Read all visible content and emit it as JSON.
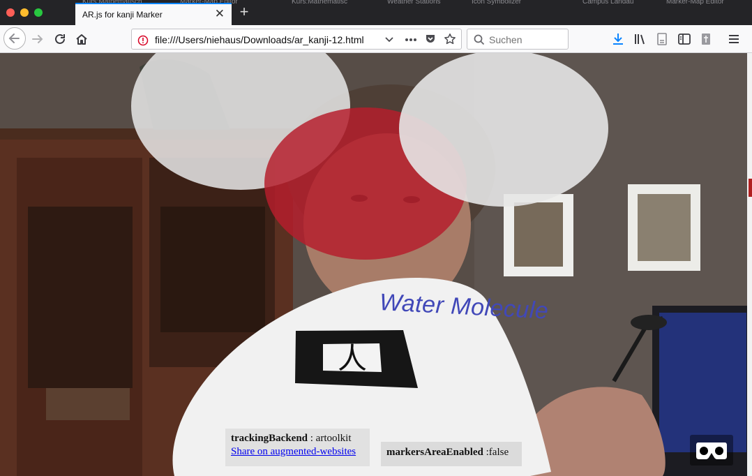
{
  "browser": {
    "active_tab": {
      "title": "AR.js for kanji Marker",
      "close_glyph": "✕"
    },
    "background_tabs": [
      "Kurs:Mathematisch",
      "Marker-Map Editor",
      "Kurs:Mathematisc",
      "Weather Stations",
      "Icon Symbolizer",
      "Campus Landau",
      "Marker-Map Editor"
    ],
    "new_tab_glyph": "+",
    "url": "file:///Users/niehaus/Downloads/ar_kanji-12.html",
    "search_placeholder": "Suchen",
    "icons": [
      "back-icon",
      "forward-icon",
      "reload-icon",
      "home-icon",
      "info-icon",
      "dropdown-icon",
      "page-actions-icon",
      "pocket-icon",
      "bookmark-star-icon",
      "search-icon",
      "download-icon",
      "library-icon",
      "reader-icon",
      "sidebar-icon",
      "extension-icon",
      "menu-icon"
    ]
  },
  "ar": {
    "label": "Water Molecule",
    "colors": {
      "oxygen": "#b51e2c",
      "hydrogen": "#e6e6e6",
      "label": "#4148b8"
    }
  },
  "stats": {
    "tracking_backend_key": "trackingBackend",
    "tracking_backend_value": " : artoolkit",
    "share_link": "Share on augmented-websites",
    "markers_key": "markersAreaEnabled",
    "markers_value": " :false"
  },
  "marker": {
    "glyph": "人"
  }
}
